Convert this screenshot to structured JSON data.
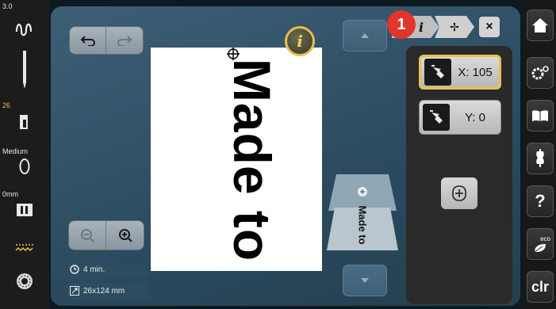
{
  "left_status": {
    "version": "3.0",
    "stitch_width": "26",
    "foot_pressure": "Medium",
    "needle_position": "0mm"
  },
  "info_panel": {
    "time": "4 min.",
    "size": "26x124 mm"
  },
  "canvas": {
    "design_text": "Made to",
    "thumbnail_text": "Made to"
  },
  "tabs": {
    "info_label": "i",
    "move_label": "✢",
    "close_label": "×"
  },
  "coords": {
    "x_label": "X: 105",
    "y_label": "Y: 0"
  },
  "badge": {
    "number": "1"
  },
  "right_menu": {
    "clr_label": "clr",
    "eco_label": "eco",
    "help_label": "?"
  },
  "colors": {
    "accent": "#e8c04a",
    "badge": "#e0342c"
  }
}
